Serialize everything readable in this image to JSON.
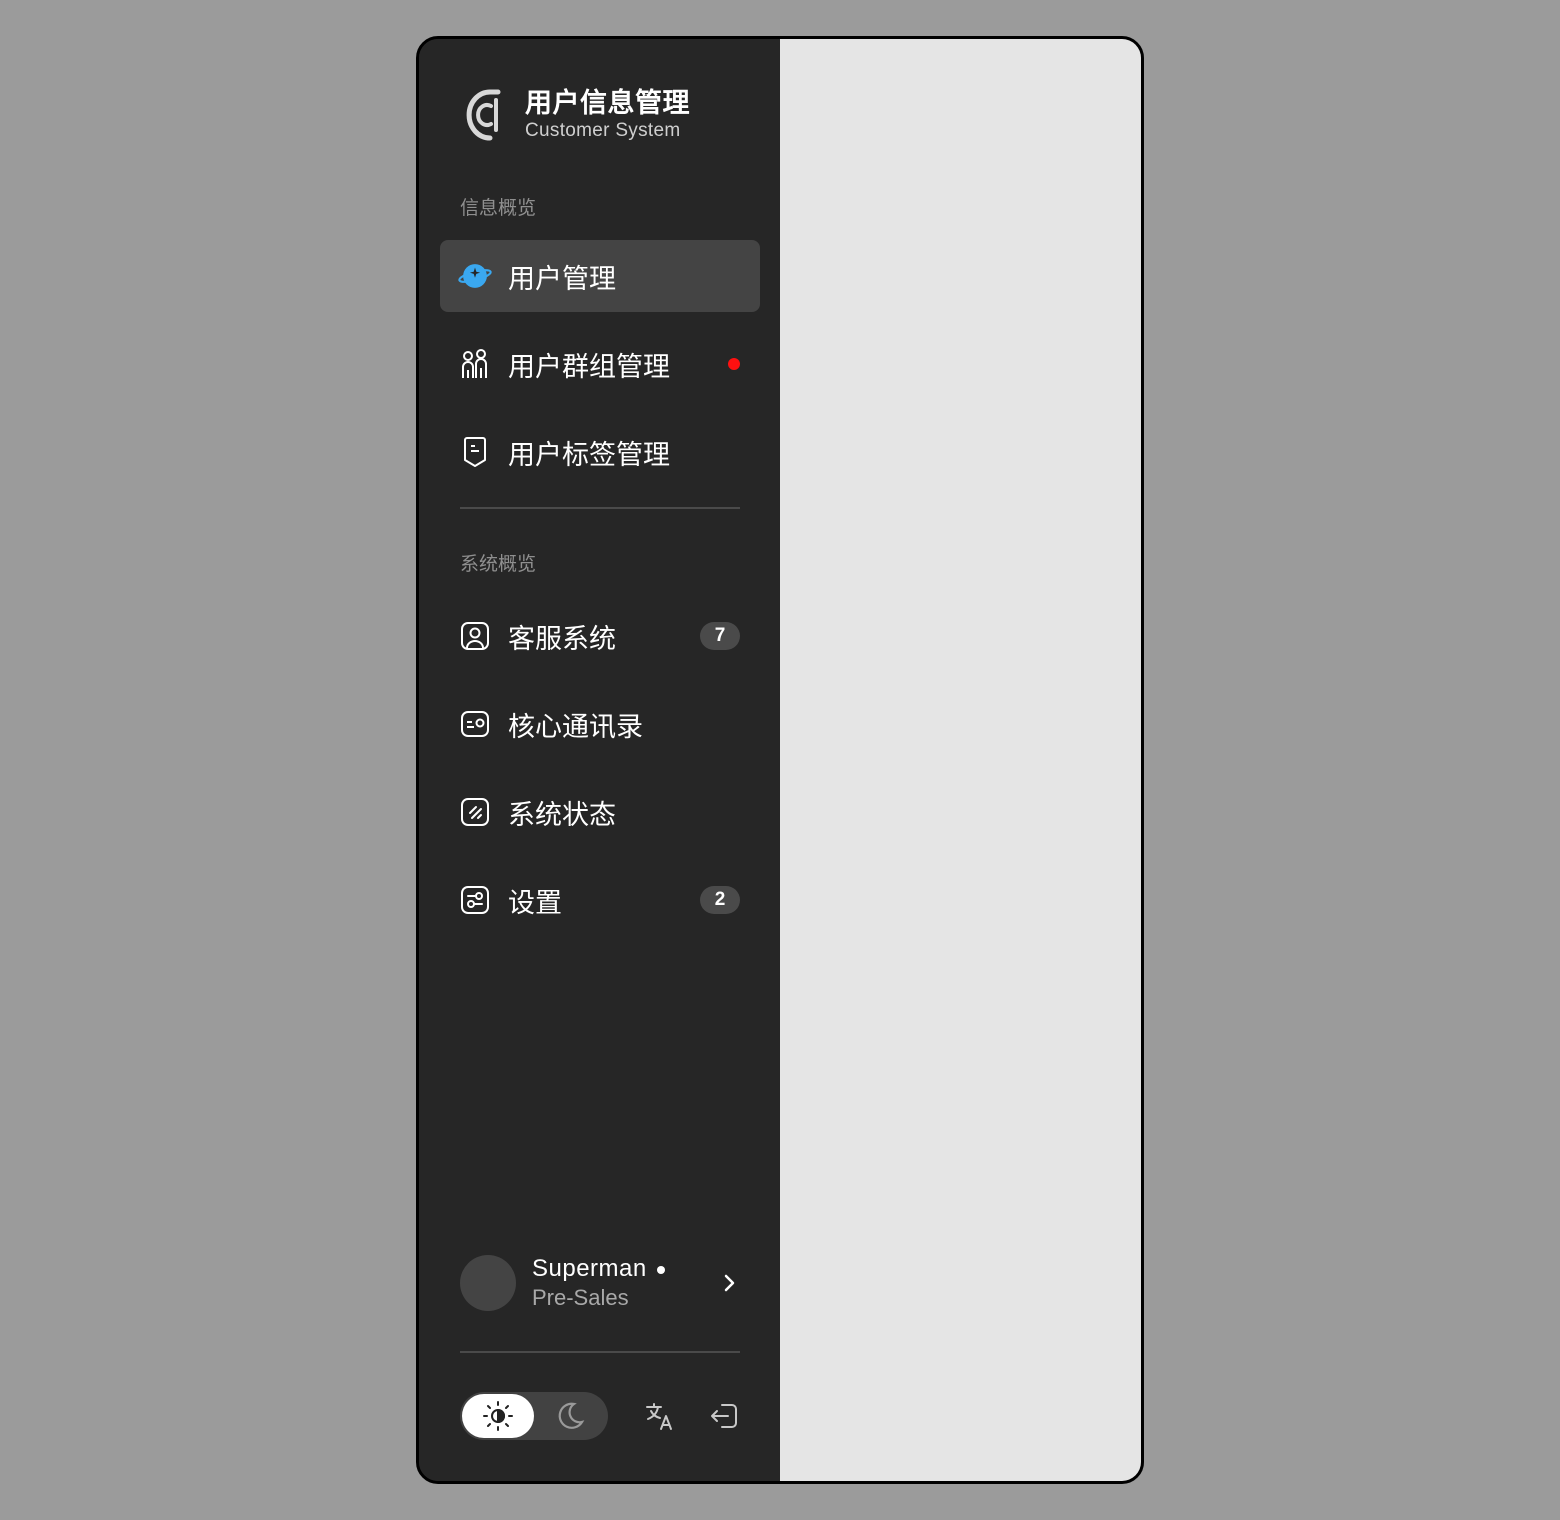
{
  "brand": {
    "title": "用户信息管理",
    "subtitle": "Customer System",
    "logo_icon": "c-logo-icon"
  },
  "sections": {
    "info": "信息概览",
    "system": "系统概览"
  },
  "nav_info": [
    {
      "label": "用户管理",
      "icon": "planet-icon",
      "active": true
    },
    {
      "label": "用户群组管理",
      "icon": "users-group-icon",
      "notification_dot": true
    },
    {
      "label": "用户标签管理",
      "icon": "tag-icon"
    }
  ],
  "nav_system": [
    {
      "label": "客服系统",
      "icon": "user-square-icon",
      "badge": "7"
    },
    {
      "label": "核心通讯录",
      "icon": "contact-card-icon"
    },
    {
      "label": "系统状态",
      "icon": "status-slash-icon"
    },
    {
      "label": "设置",
      "icon": "settings-toggle-icon",
      "badge": "2"
    }
  ],
  "profile": {
    "name": "Superman",
    "role": "Pre-Sales",
    "status": "online"
  },
  "controls": {
    "theme_selected": "light",
    "light_icon": "sun-icon",
    "dark_icon": "moon-icon",
    "language_icon": "translate-icon",
    "logout_icon": "logout-icon"
  },
  "colors": {
    "sidebar_bg": "#262626",
    "content_bg": "#e5e5e5",
    "active_item_bg": "#444444",
    "accent_blue": "#3aa8f0",
    "notification_red": "#ff1010"
  }
}
